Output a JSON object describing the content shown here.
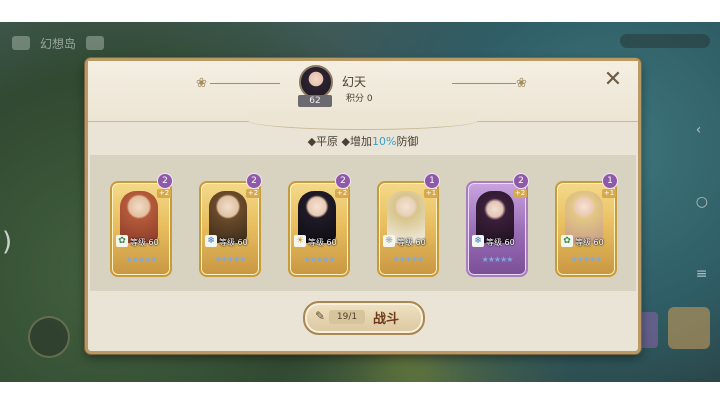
{
  "background": {
    "topbar_text": "幻想岛",
    "left_paren": ")"
  },
  "dialog": {
    "player_name": "幻天",
    "player_level": "62",
    "score": "积分 0",
    "close_symbol": "✕",
    "terrain_prefix": "◆平原 ◆增加",
    "terrain_bonus": "10%",
    "terrain_suffix": "防御",
    "heroes": [
      {
        "level_text": "等级 60",
        "element": "✿",
        "grade": "2",
        "plus": "+2",
        "color": "gold"
      },
      {
        "level_text": "等级 60",
        "element": "❄",
        "grade": "2",
        "plus": "+2",
        "color": "gold"
      },
      {
        "level_text": "等级 60",
        "element": "☀",
        "grade": "2",
        "plus": "+2",
        "color": "gold"
      },
      {
        "level_text": "等级 60",
        "element": "❋",
        "grade": "1",
        "plus": "+1",
        "color": "gold"
      },
      {
        "level_text": "等级 60",
        "element": "❄",
        "grade": "2",
        "plus": "+2",
        "color": "purple"
      },
      {
        "level_text": "等级 60",
        "element": "✿",
        "grade": "1",
        "plus": "+1",
        "color": "gold"
      }
    ],
    "stars": "★★★★★",
    "fight_button": {
      "ticket_count": "19/1",
      "label": "战斗"
    }
  },
  "colors": {
    "accent_blue": "#3aa0c8",
    "card_gold": "#e9bf60",
    "card_purple": "#9c6fb9",
    "fight_text": "#6e3a1c"
  },
  "icons": [
    "avatar-portrait",
    "close-icon",
    "element-icon",
    "star-icon",
    "grade-badge",
    "ticket-icon"
  ]
}
